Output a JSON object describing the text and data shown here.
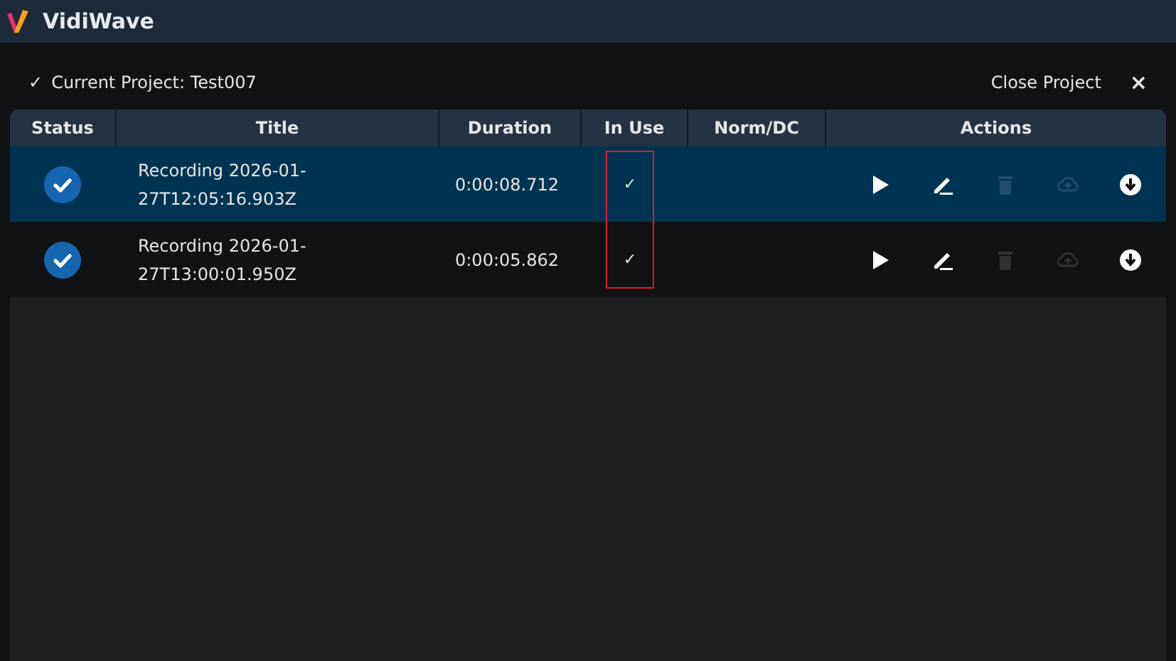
{
  "window": {
    "title": "VidiWave"
  },
  "project": {
    "check": "✓",
    "label": "Current Project: Test007",
    "close_label": "Close Project",
    "close_icon": "×"
  },
  "table": {
    "columns": [
      "Status",
      "Title",
      "Duration",
      "In Use",
      "Norm/DC",
      "Actions"
    ],
    "in_use_highlighted": true,
    "rows": [
      {
        "selected": true,
        "status_ok": true,
        "title_lines": [
          "Recording 2026-01-",
          "27T12:05:16.903Z"
        ],
        "duration": "0:00:08.712",
        "in_use": "✓",
        "actions": [
          {
            "kind": "play",
            "disabled": false
          },
          {
            "kind": "edit",
            "disabled": false
          },
          {
            "kind": "delete",
            "disabled": true
          },
          {
            "kind": "upload",
            "disabled": true
          },
          {
            "kind": "download",
            "disabled": false
          }
        ]
      },
      {
        "selected": false,
        "status_ok": true,
        "title_lines": [
          "Recording 2026-01-",
          "27T13:00:01.950Z"
        ],
        "duration": "0:00:05.862",
        "in_use": "✓",
        "actions": [
          {
            "kind": "play",
            "disabled": false
          },
          {
            "kind": "edit",
            "disabled": false
          },
          {
            "kind": "delete",
            "disabled": true
          },
          {
            "kind": "upload",
            "disabled": true
          },
          {
            "kind": "download",
            "disabled": false
          }
        ]
      }
    ]
  }
}
